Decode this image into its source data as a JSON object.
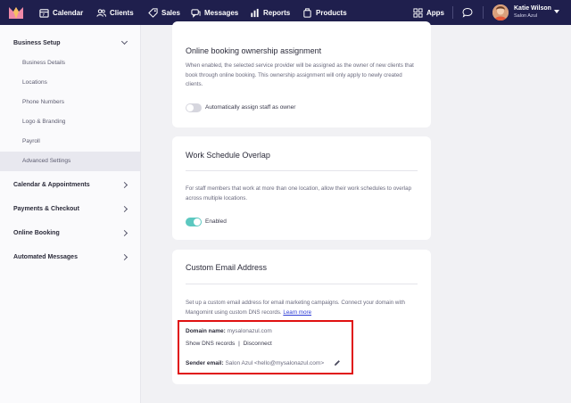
{
  "nav": {
    "items": [
      {
        "label": "Calendar",
        "icon": "calendar-icon"
      },
      {
        "label": "Clients",
        "icon": "users-icon"
      },
      {
        "label": "Sales",
        "icon": "tag-icon"
      },
      {
        "label": "Messages",
        "icon": "messages-icon"
      },
      {
        "label": "Reports",
        "icon": "reports-icon"
      },
      {
        "label": "Products",
        "icon": "products-icon"
      }
    ],
    "apps_label": "Apps",
    "user_name": "Katie Wilson",
    "user_business": "Salon Azul"
  },
  "sidebar": {
    "business_setup": "Business Setup",
    "sub_items": [
      "Business Details",
      "Locations",
      "Phone Numbers",
      "Logo & Branding",
      "Payroll",
      "Advanced Settings"
    ],
    "sections": [
      "Calendar & Appointments",
      "Payments & Checkout",
      "Online Booking",
      "Automated Messages"
    ]
  },
  "cards": {
    "ownership": {
      "title": "Online booking ownership assignment",
      "description": "When enabled, the selected service provider will be assigned as the owner of new clients that book through online booking. This ownership assignment will only apply to newly created clients.",
      "toggle_label": "Automatically assign staff as owner",
      "enabled": false
    },
    "overlap": {
      "title": "Work Schedule Overlap",
      "description": "For staff members that work at more than one location, allow their work schedules to overlap across multiple locations.",
      "toggle_label": "Enabled",
      "enabled": true
    },
    "email": {
      "title": "Custom Email Address",
      "description": "Set up a custom email address for email marketing campaigns. Connect your domain with Mangomint using custom DNS records.",
      "learn_more": "Learn more",
      "domain_label": "Domain name:",
      "domain_value": "mysalonazul.com",
      "show_dns": "Show DNS records",
      "separator": "|",
      "disconnect": "Disconnect",
      "sender_label": "Sender email:",
      "sender_value": "Salon Azul <hello@mysalonazul.com>"
    }
  },
  "colors": {
    "nav_bg": "#1f1f4d",
    "toggle_on": "#5cc8c0",
    "toggle_off": "#d6d6de",
    "link": "#2b3bd6",
    "highlight": "#e01010"
  }
}
